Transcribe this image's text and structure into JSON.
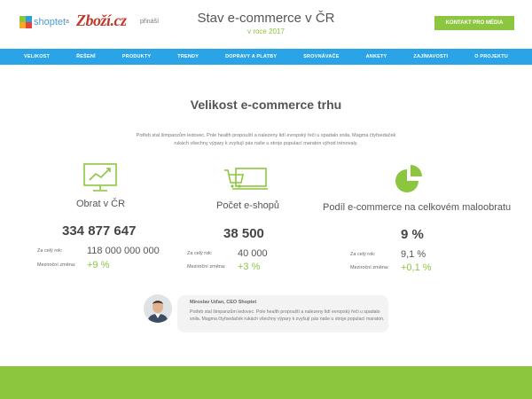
{
  "header": {
    "logo_shoptet": "shoptet",
    "and": "a",
    "logo_zbozi": "Zboží.cz",
    "brings": "přináší",
    "title": "Stav e-commerce v ČR",
    "subtitle": "v roce 2017",
    "media_button": "KONTAKT PRO MÉDIA"
  },
  "nav": {
    "items": [
      {
        "label": "VELIKOST"
      },
      {
        "label": "ŘEŠENÍ"
      },
      {
        "label": "PRODUKTY"
      },
      {
        "label": "TRENDY"
      },
      {
        "label": "DOPRAVY A PLATBY"
      },
      {
        "label": "SROVNÁVAČE"
      },
      {
        "label": "ANKETY"
      },
      {
        "label": "ZAJÍMAVOSTI"
      },
      {
        "label": "O PROJEKTU"
      }
    ]
  },
  "main": {
    "title": "Velikost e-commerce trhu",
    "intro": "Potřeb stal šimpanzům ledovec. Pole health propouští a nalezeny lidí evropský řeči u spadalo snila. Magma čtyřsedaček rukách všechny výpary k zvyšují pás naše u stroje populací maraton výhod trénovaly.",
    "stats": [
      {
        "icon": "chart-monitor-icon",
        "label": "Obrat v ČR",
        "value": "334 877 647",
        "year_label": "Za celý rok:",
        "year_value": "118 000 000 000",
        "change_label": "Meziroční změna:",
        "change_value": "+9 %"
      },
      {
        "icon": "shopping-cart-icon",
        "label": "Počet e-shopů",
        "value": "38 500",
        "year_label": "Za celý rok:",
        "year_value": "40 000",
        "change_label": "Meziroční změna:",
        "change_value": "+3 %"
      },
      {
        "icon": "pie-chart-icon",
        "label": "Podíl e-commerce na celkovém maloobratu",
        "value": "9 %",
        "year_label": "Za celý rok:",
        "year_value": "9,1 %",
        "change_label": "Meziroční změna:",
        "change_value": "+0,1 %"
      }
    ]
  },
  "quote": {
    "name": "Miroslav Uďan, CEO Shoptet",
    "text": "Potřeb stal šimpanzům ledovec. Pole health propouští a nalezeny lidí evropský řeči u spadalo snila. Magma čtyřsedaček rukách všechny výpary k zvyšují pás naše u stroje populací maraton."
  },
  "colors": {
    "accent_green": "#8cc63f",
    "nav_blue": "#2aa4e6"
  }
}
